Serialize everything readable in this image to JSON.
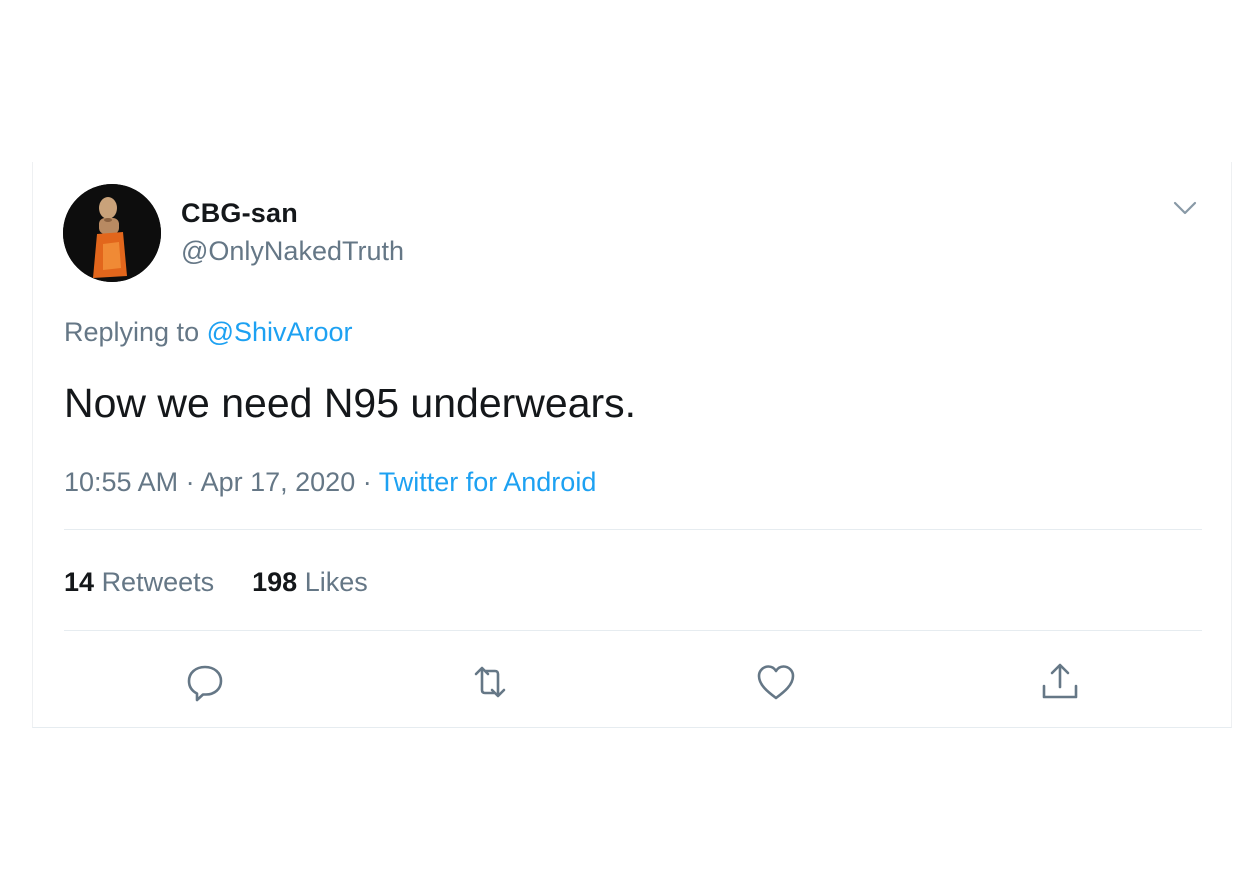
{
  "tweet": {
    "author": {
      "display_name": "CBG-san",
      "handle": "@OnlyNakedTruth"
    },
    "reply_prefix": "Replying to ",
    "reply_to": "@ShivAroor",
    "text": "Now we need N95 underwears.",
    "time": "10:55 AM",
    "date": "Apr 17, 2020",
    "separator": " · ",
    "source": "Twitter for Android",
    "stats": {
      "retweets_count": "14",
      "retweets_label": "Retweets",
      "likes_count": "198",
      "likes_label": "Likes"
    },
    "actions": [
      {
        "icon": "reply-icon"
      },
      {
        "icon": "retweet-icon"
      },
      {
        "icon": "like-icon"
      },
      {
        "icon": "share-icon"
      }
    ]
  },
  "colors": {
    "text_primary": "#14171a",
    "text_secondary": "#657786",
    "link": "#1da1f2",
    "divider": "#e6ecf0"
  }
}
